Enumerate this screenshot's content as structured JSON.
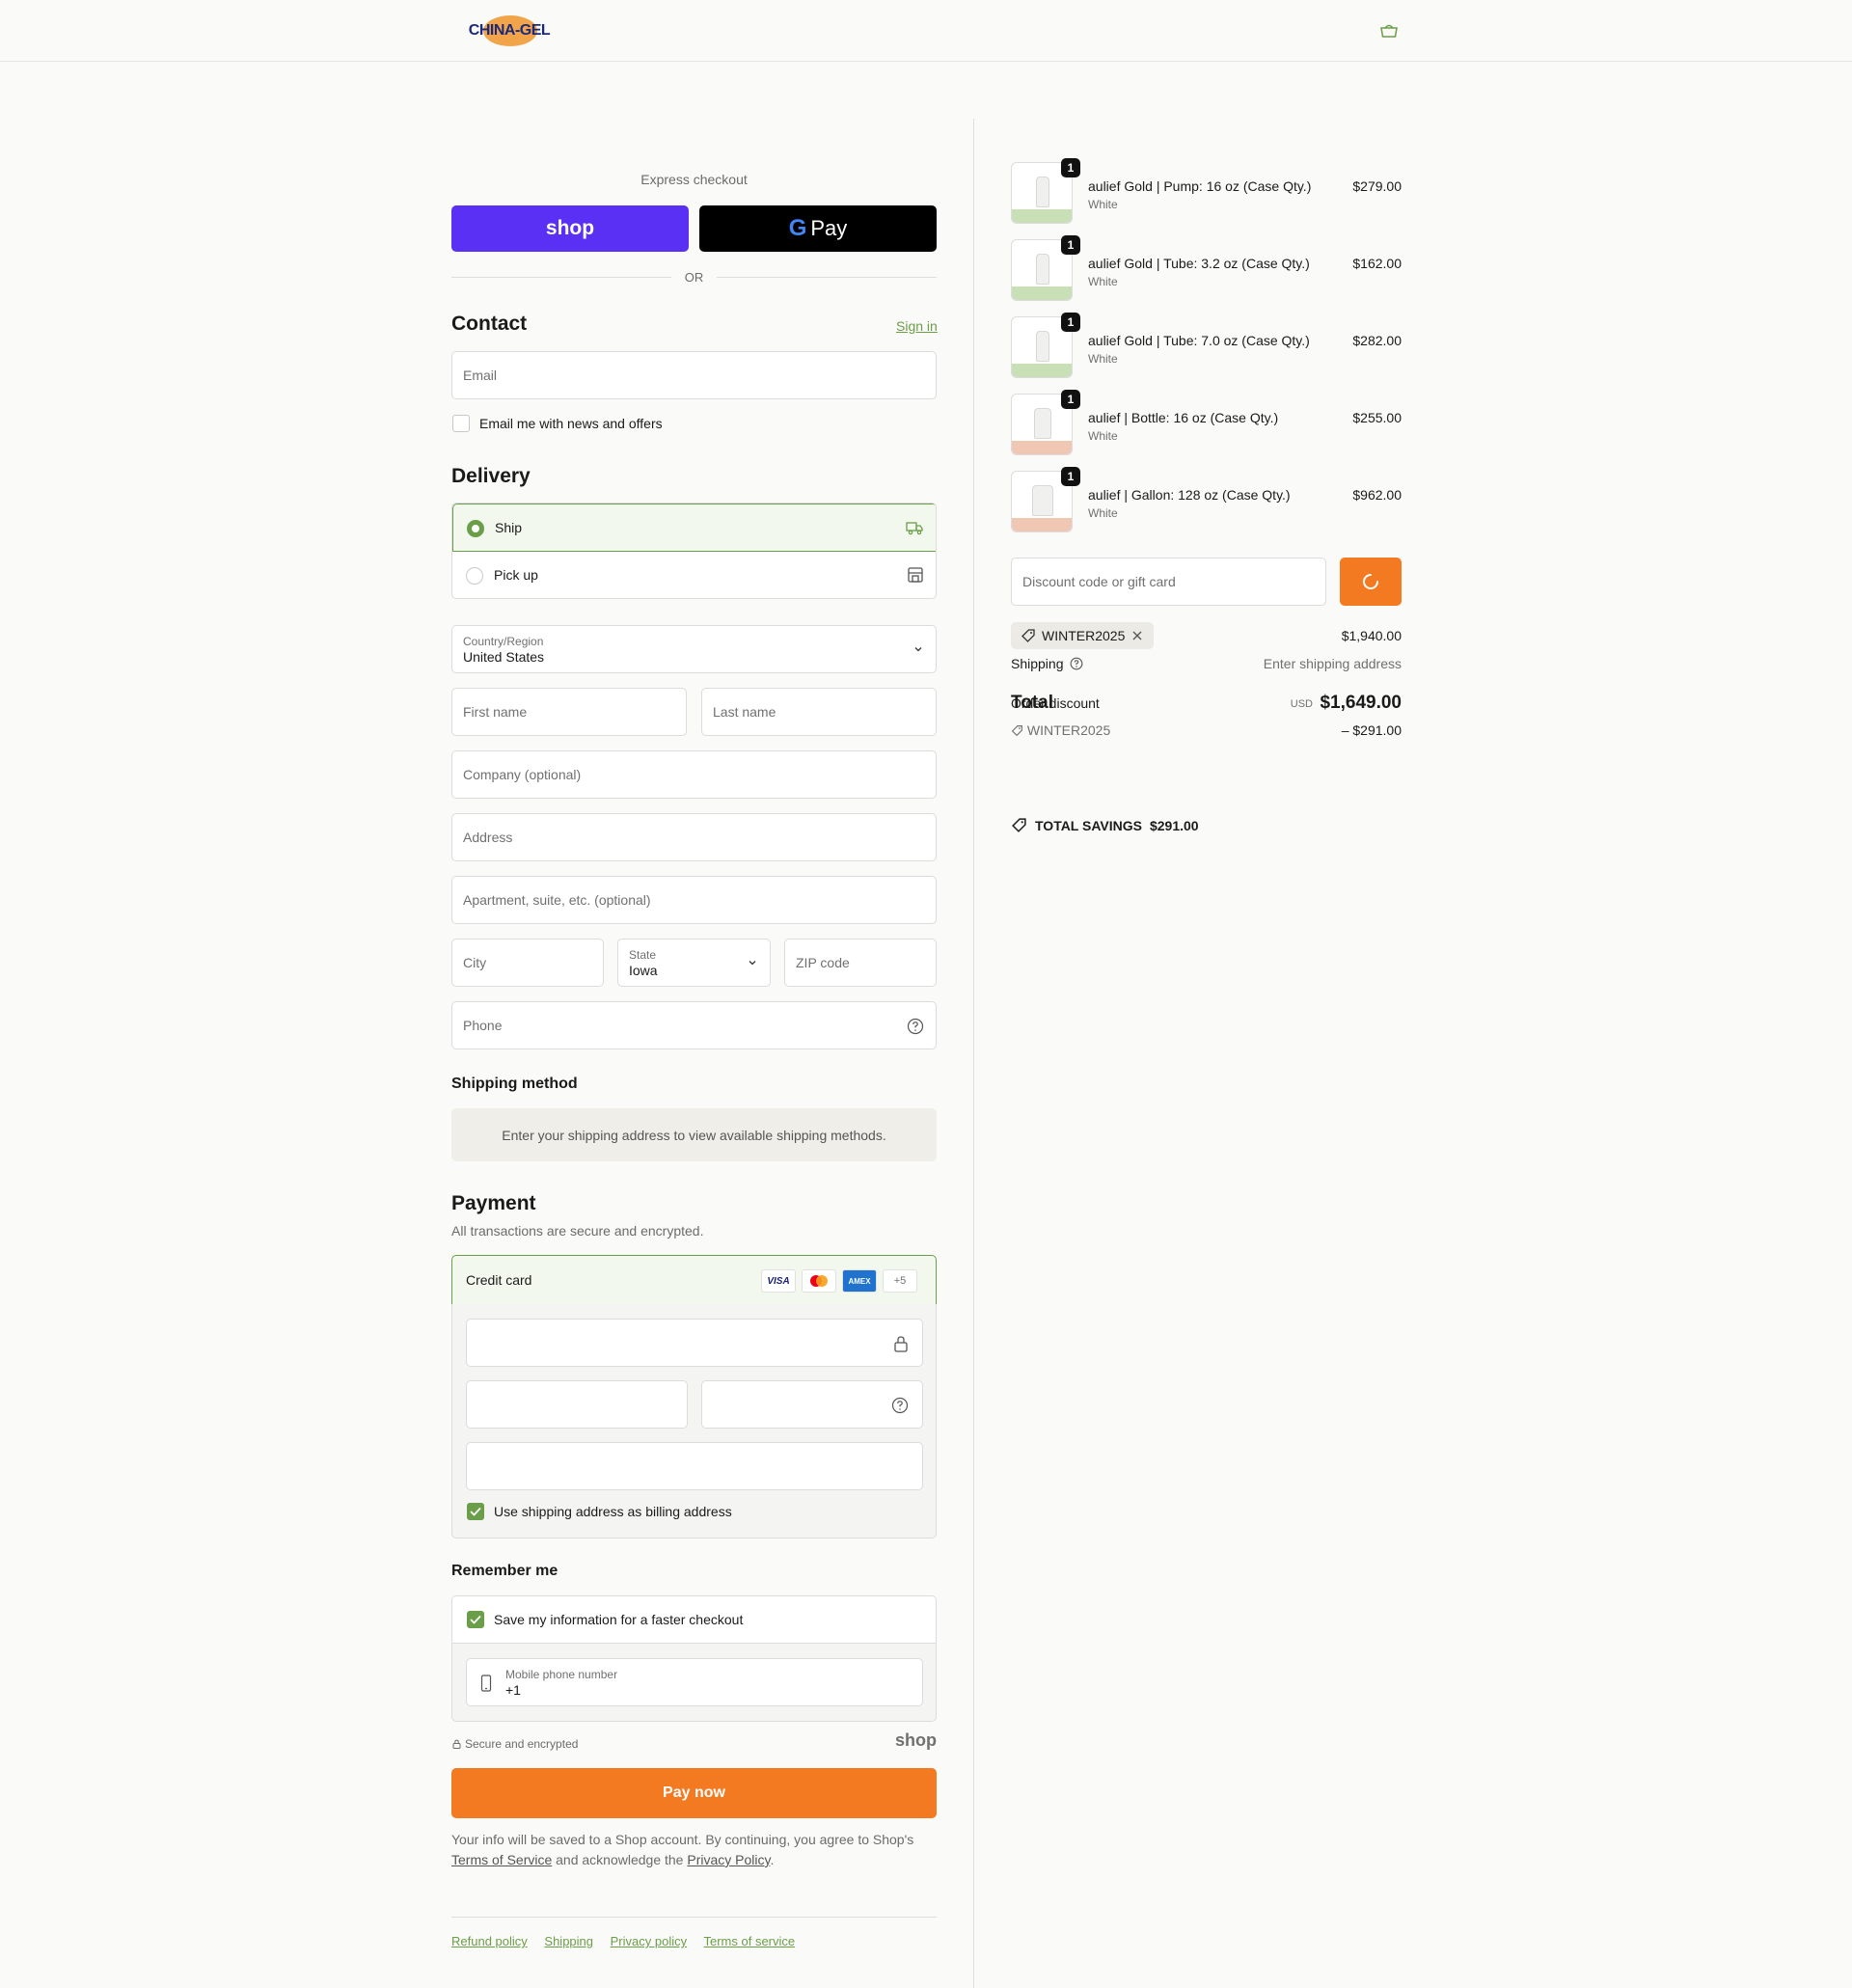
{
  "header": {
    "logo_text": "CHINA-GEL",
    "bag_icon": "shopping-bag-icon"
  },
  "express": {
    "label": "Express checkout",
    "shop_label": "shop",
    "gpay_label": "Pay",
    "gpay_g": "G",
    "or_label": "OR"
  },
  "contact": {
    "title": "Contact",
    "sign_in": "Sign in",
    "email_placeholder": "Email",
    "news_label": "Email me with news and offers"
  },
  "delivery": {
    "title": "Delivery",
    "options": [
      {
        "label": "Ship",
        "selected": true,
        "icon": "truck-icon"
      },
      {
        "label": "Pick up",
        "selected": false,
        "icon": "store-icon"
      }
    ],
    "country_label": "Country/Region",
    "country_value": "United States",
    "first_name": "First name",
    "last_name": "Last name",
    "company": "Company (optional)",
    "address": "Address",
    "apartment": "Apartment, suite, etc. (optional)",
    "city": "City",
    "state_label": "State",
    "state_value": "Iowa",
    "zip": "ZIP code",
    "phone": "Phone"
  },
  "shipping_method": {
    "title": "Shipping method",
    "info": "Enter your shipping address to view available shipping methods."
  },
  "payment": {
    "title": "Payment",
    "subtitle": "All transactions are secure and encrypted.",
    "credit_card_label": "Credit card",
    "card_brands": [
      "VISA",
      "MC",
      "AMEX"
    ],
    "more_brands": "+5",
    "billing_label": "Use shipping address as billing address"
  },
  "remember": {
    "title": "Remember me",
    "save_label": "Save my information for a faster checkout",
    "phone_label": "Mobile phone number",
    "phone_value": "+1",
    "secure_label": "Secure and encrypted",
    "shop_label": "shop"
  },
  "pay_now": "Pay now",
  "legal": {
    "part1": "Your info will be saved to a Shop account. By continuing, you agree to Shop's",
    "tos": "Terms of Service",
    "part2": "and acknowledge the",
    "privacy": "Privacy Policy",
    "end": "."
  },
  "footer_links": [
    "Refund policy",
    "Shipping",
    "Privacy policy",
    "Terms of service"
  ],
  "cart": {
    "items": [
      {
        "name": "aulief Gold | Pump: 16 oz (Case Qty.)",
        "variant": "White",
        "price": "$279.00",
        "qty": "1",
        "base_color": "#c9dfb5"
      },
      {
        "name": "aulief Gold | Tube: 3.2 oz (Case Qty.)",
        "variant": "White",
        "price": "$162.00",
        "qty": "1",
        "base_color": "#c9dfb5"
      },
      {
        "name": "aulief Gold | Tube: 7.0 oz (Case Qty.)",
        "variant": "White",
        "price": "$282.00",
        "qty": "1",
        "base_color": "#c9dfb5"
      },
      {
        "name": "aulief | Bottle: 16 oz (Case Qty.)",
        "variant": "White",
        "price": "$255.00",
        "qty": "1",
        "base_color": "#efc7b3"
      },
      {
        "name": "aulief | Gallon: 128 oz (Case Qty.)",
        "variant": "White",
        "price": "$962.00",
        "qty": "1",
        "base_color": "#efc7b3"
      }
    ],
    "discount_placeholder": "Discount code or gift card",
    "applied_code": "WINTER2025",
    "subtotal": "$1,940.00",
    "shipping_label": "Shipping",
    "shipping_value": "Enter shipping address",
    "total_label": "Total",
    "order_discount_label": "Order discount",
    "currency": "USD",
    "total_value": "$1,649.00",
    "discount_code": "WINTER2025",
    "discount_value": "– $291.00",
    "savings_label": "TOTAL SAVINGS",
    "savings_value": "$291.00"
  },
  "colors": {
    "accent_green": "#6a9e48",
    "pay_orange": "#f37a21",
    "shop_purple": "#5a31f4"
  }
}
